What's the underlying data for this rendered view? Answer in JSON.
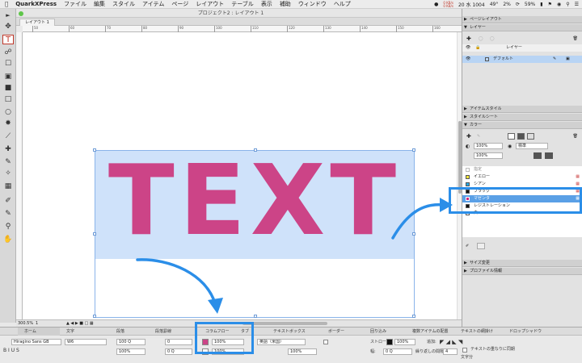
{
  "menubar": {
    "app_name": "QuarkXPress",
    "items": [
      "ファイル",
      "編集",
      "スタイル",
      "アイテム",
      "ページ",
      "レイアウト",
      "テーブル",
      "表示",
      "補助",
      "ウィンドウ",
      "ヘルプ"
    ],
    "network_up": "0 KB/s",
    "network_down": "0 KB/s",
    "date": "20 水 1004",
    "temp": "49°",
    "cpu": "2%",
    "battery": "59%"
  },
  "window": {
    "title": "プロジェクト2 : レイアウト 1",
    "tab_label": "レイアウト 1",
    "ruler_labels": [
      "50",
      "60",
      "70",
      "80",
      "90",
      "100",
      "110",
      "120",
      "130",
      "140",
      "150",
      "160"
    ]
  },
  "canvas": {
    "text": "TEXT",
    "text_color": "#cc4487",
    "box_color": "#cfe2fa"
  },
  "statusbar": {
    "zoom": "300.5%",
    "page": "1"
  },
  "measurement": {
    "tabs": [
      "ホーム",
      "文字",
      "段落",
      "段落罫線",
      "コラムフロー",
      "タブ",
      "テキストボックス",
      "ボーダー",
      "回り込み",
      "複数アイテムの配置",
      "テキストの網掛け",
      "ドロップシャドウ"
    ],
    "font": "Hiragino Sans GB",
    "weight": "W6",
    "size": "100 Q",
    "tracking": "0",
    "kerning": "0 Q",
    "shade": "100%",
    "shade2": "100%",
    "language": "英語（米国）",
    "scale": "100%",
    "scale2": "100%",
    "stroke_label": "ストローク:",
    "stroke_value": "100%",
    "width_label": "幅:",
    "width_value": "0 Q",
    "add_label": "追加:",
    "nest_label": "テキストの重なりに同期",
    "spacing_label": "繰り返しの間隔:",
    "spacing_value": "4",
    "unit_label": "文字分"
  },
  "panel": {
    "page_layout": "ページレイアウト",
    "layers": "レイヤー",
    "layers_col": "レイヤー",
    "layer_default": "デフォルト",
    "item_styles": "アイテムスタイル",
    "style_sheets": "スタイルシート",
    "colors": "カラー",
    "shade_a": "100%",
    "shade_b": "100%",
    "blend": "標準",
    "color_list": [
      {
        "name": "指定",
        "swatch": "#ffffff"
      },
      {
        "name": "イエロー",
        "swatch": "#f3e63a"
      },
      {
        "name": "シアン",
        "swatch": "#29a8e0"
      },
      {
        "name": "ブラック",
        "swatch": "#111111"
      },
      {
        "name": "マゼンタ",
        "swatch": "#d0287e"
      },
      {
        "name": "レジストレーション",
        "swatch": "#111111"
      },
      {
        "name": "白",
        "swatch": "#ffffff"
      }
    ],
    "size_change": "サイズ変更",
    "profile_info": "プロファイル情報"
  },
  "colors": {
    "highlight": "#2b8ee8",
    "selected_row": "#5aa0e6"
  }
}
